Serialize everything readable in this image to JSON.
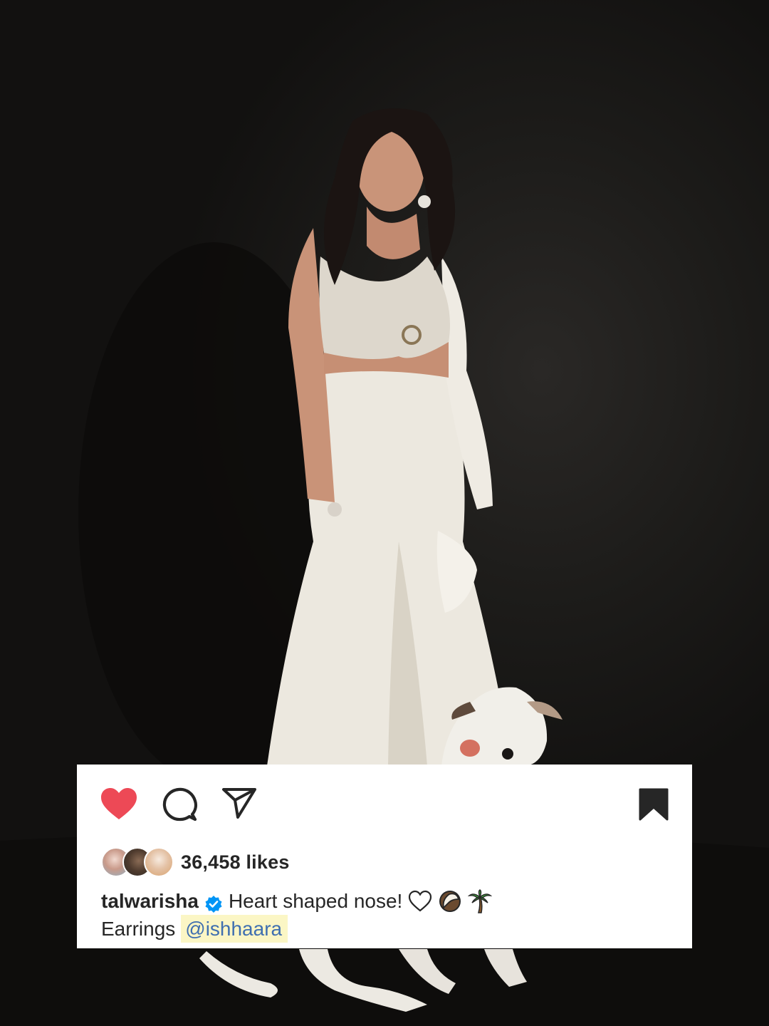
{
  "post": {
    "likes_text": "36,458 likes",
    "username": "talwarisha",
    "caption_text": "Heart shaped nose!",
    "caption_emojis": [
      "heart-outline",
      "coconut",
      "palm-tree"
    ],
    "line2_prefix": "Earrings",
    "mention": "@ishhaara"
  },
  "icons": {
    "like": "heart-icon",
    "comment": "comment-icon",
    "share": "send-icon",
    "save": "bookmark-icon",
    "verified": "verified-badge-icon"
  },
  "colors": {
    "like_active": "#ed4956",
    "text": "#262626",
    "verified": "#0095f6",
    "mention": "#3f6fb0",
    "mention_highlight": "#fbf6c5"
  }
}
